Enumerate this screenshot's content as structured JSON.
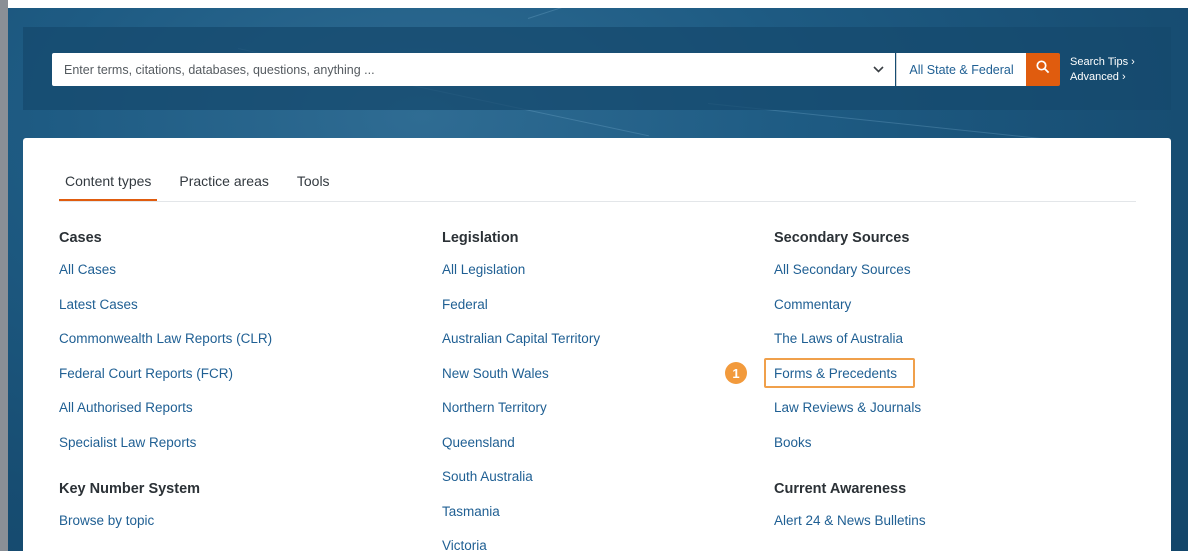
{
  "search": {
    "placeholder": "Enter terms, citations, databases, questions, anything ...",
    "jurisdiction": "All State & Federal",
    "search_tips": "Search Tips ›",
    "advanced": "Advanced ›"
  },
  "tabs": [
    {
      "label": "Content types",
      "active": true
    },
    {
      "label": "Practice areas",
      "active": false
    },
    {
      "label": "Tools",
      "active": false
    }
  ],
  "columns": {
    "cases": {
      "heading": "Cases",
      "links": [
        "All Cases",
        "Latest Cases",
        "Commonwealth Law Reports (CLR)",
        "Federal Court Reports (FCR)",
        "All Authorised Reports",
        "Specialist Law Reports"
      ],
      "heading2": "Key Number System",
      "links2": [
        "Browse by topic"
      ]
    },
    "legislation": {
      "heading": "Legislation",
      "links": [
        "All Legislation",
        "Federal",
        "Australian Capital Territory",
        "New South Wales",
        "Northern Territory",
        "Queensland",
        "South Australia",
        "Tasmania",
        "Victoria"
      ]
    },
    "secondary": {
      "heading": "Secondary Sources",
      "links": [
        "All Secondary Sources",
        "Commentary",
        "The Laws of Australia",
        "Forms & Precedents",
        "Law Reviews & Journals",
        "Books"
      ],
      "heading2": "Current Awareness",
      "links2": [
        "Alert 24 & News Bulletins"
      ]
    }
  },
  "callout": {
    "number": "1"
  },
  "colors": {
    "accent": "#e05c0e",
    "link": "#1f5f93",
    "callout": "#f29a3c"
  }
}
